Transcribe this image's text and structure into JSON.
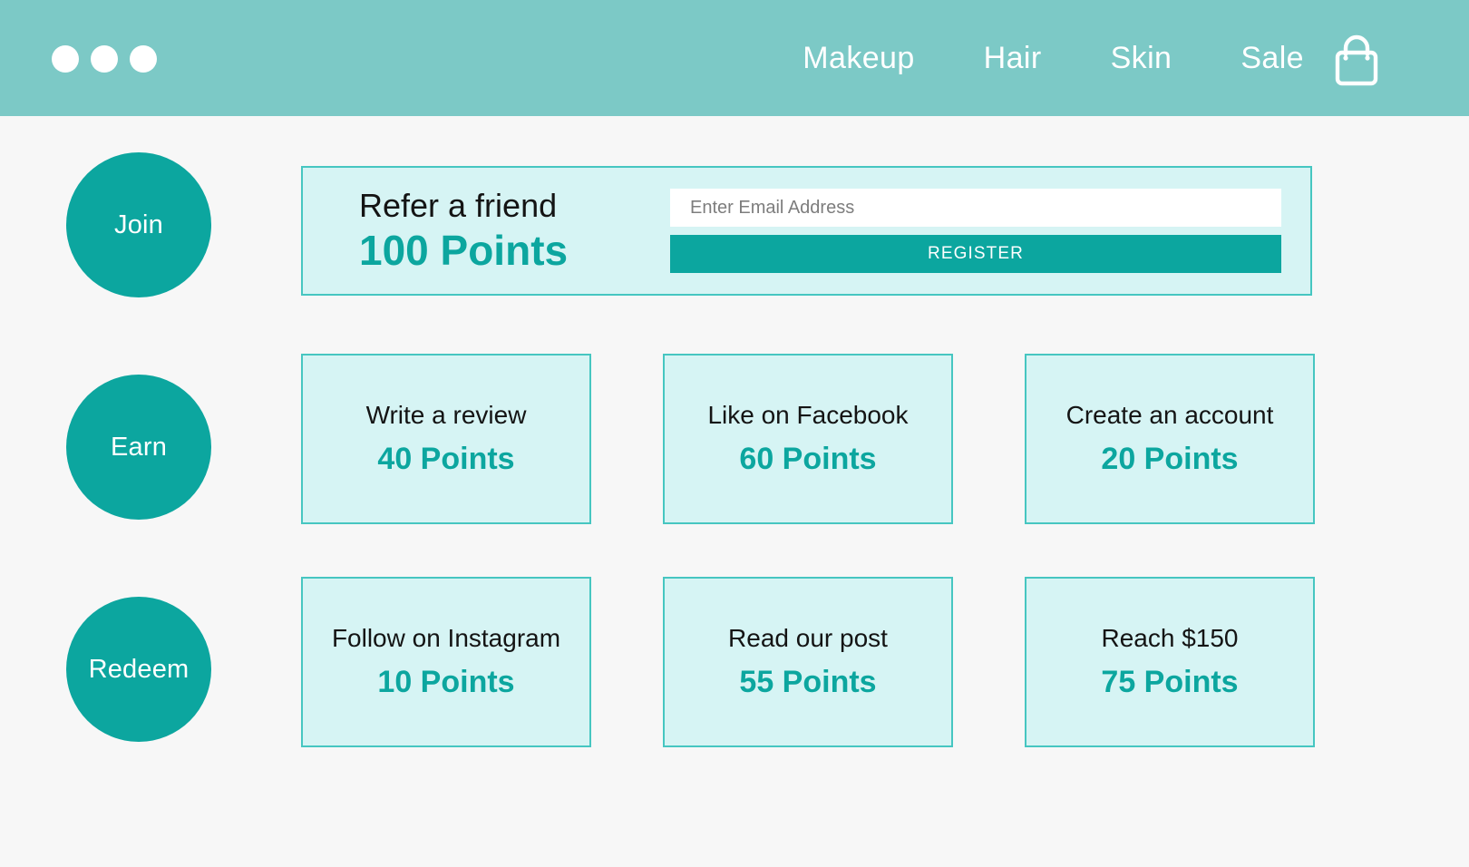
{
  "theme": {
    "header_bg": "#7cc9c6",
    "accent": "#0ca69f",
    "card_bg": "#d6f4f4",
    "card_border": "#46c6c1",
    "page_bg": "#f7f7f7",
    "text_dark": "#141414"
  },
  "header": {
    "logo_icon": "three-dots-logo",
    "cart_icon": "shopping-bag-icon",
    "nav": [
      {
        "label": "Makeup"
      },
      {
        "label": "Hair"
      },
      {
        "label": "Skin"
      },
      {
        "label": "Sale"
      }
    ]
  },
  "steps": [
    {
      "label": "Join"
    },
    {
      "label": "Earn"
    },
    {
      "label": "Redeem"
    }
  ],
  "refer": {
    "title": "Refer a friend",
    "points": "100 Points",
    "email_placeholder": "Enter Email Address",
    "email_value": "",
    "register_label": "REGISTER"
  },
  "rewards": [
    {
      "label": "Write a review",
      "points": "40 Points"
    },
    {
      "label": "Like on Facebook",
      "points": "60 Points"
    },
    {
      "label": "Create an account",
      "points": "20 Points"
    },
    {
      "label": "Follow on Instagram",
      "points": "10 Points"
    },
    {
      "label": "Read our post",
      "points": "55 Points"
    },
    {
      "label": "Reach $150",
      "points": "75 Points"
    }
  ]
}
